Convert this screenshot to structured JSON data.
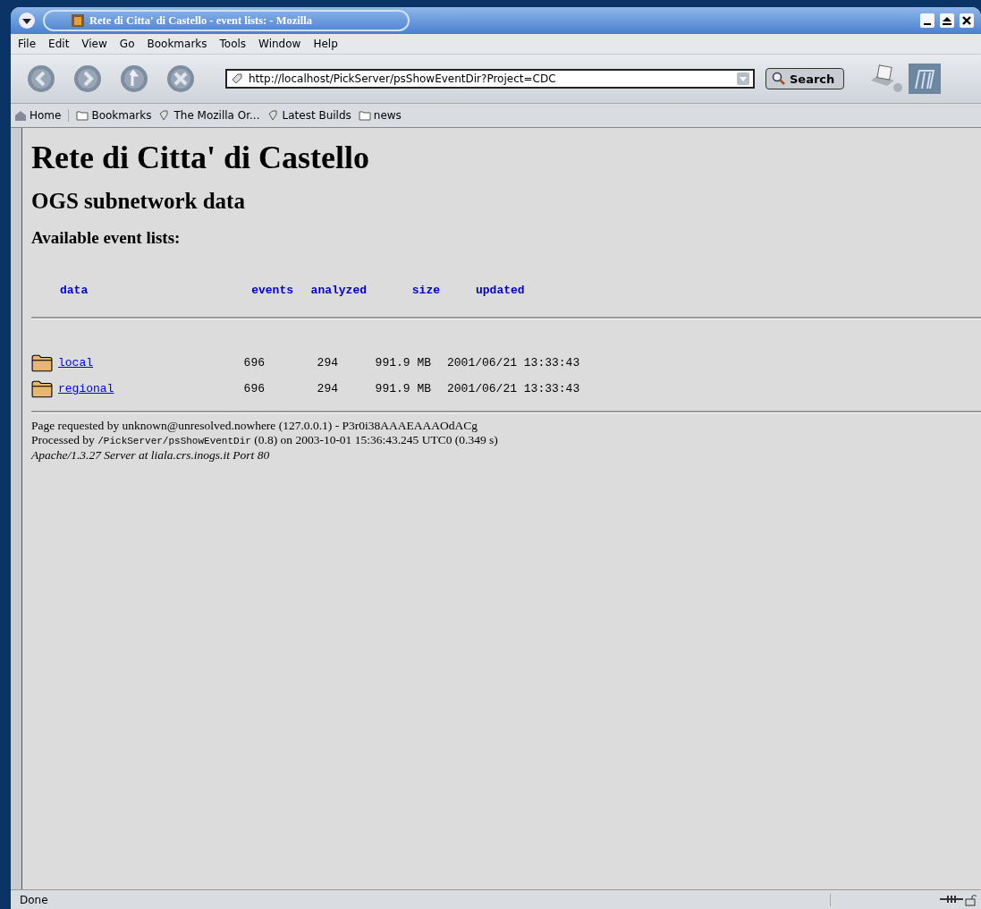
{
  "window": {
    "title": "Rete di Citta' di Castello - event lists: - Mozilla"
  },
  "menu": [
    "File",
    "Edit",
    "View",
    "Go",
    "Bookmarks",
    "Tools",
    "Window",
    "Help"
  ],
  "address": {
    "value": "http://localhost/PickServer/psShowEventDir?Project=CDC"
  },
  "search_button": "Search",
  "bookmarks": [
    {
      "kind": "home",
      "label": "Home"
    },
    {
      "kind": "folder",
      "label": "Bookmarks"
    },
    {
      "kind": "link",
      "label": "The Mozilla Or..."
    },
    {
      "kind": "link",
      "label": "Latest Builds"
    },
    {
      "kind": "folder",
      "label": "news"
    }
  ],
  "page": {
    "title": "Rete di Citta' di Castello",
    "subtitle": "OGS subnetwork data",
    "section": "Available event lists:",
    "columns": [
      "data",
      "events",
      "analyzed",
      "size",
      "updated"
    ],
    "rows": [
      {
        "name": "local",
        "events": "696",
        "analyzed": "294",
        "size": "991.9 MB",
        "updated": "2001/06/21 13:33:43"
      },
      {
        "name": "regional",
        "events": "696",
        "analyzed": "294",
        "size": "991.9 MB",
        "updated": "2001/06/21 13:33:43"
      }
    ],
    "footer": {
      "requested": "Page requested by unknown@unresolved.nowhere (127.0.0.1) - P3r0i38AAAEAAAOdACg",
      "processed_prefix": "Processed by",
      "processed_path": "/PickServer/psShowEventDir",
      "processed_suffix": "(0.8) on 2003-10-01 15:36:43.245 UTC0 (0.349 s)",
      "server": "Apache/1.3.27 Server at liala.crs.inogs.it Port 80"
    }
  },
  "status_bar": {
    "text": "Done"
  }
}
